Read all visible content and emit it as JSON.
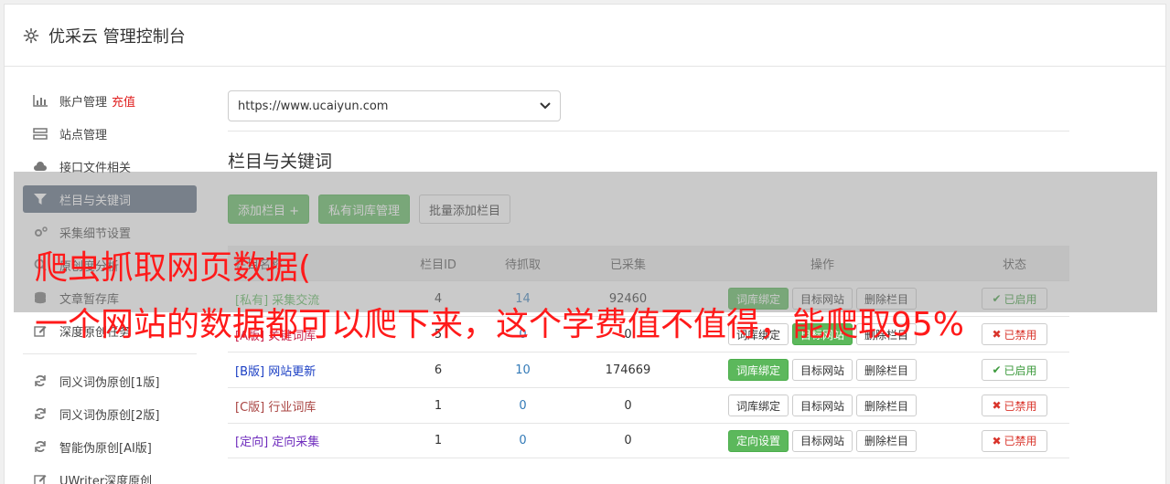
{
  "header": {
    "title": "优采云 管理控制台"
  },
  "sidebar": {
    "items": [
      {
        "label": "账户管理",
        "extra": "充值",
        "icon": "bar-chart-icon"
      },
      {
        "label": "站点管理",
        "icon": "server-icon"
      },
      {
        "label": "接口文件相关",
        "icon": "cloud-upload-icon"
      },
      {
        "label": "栏目与关键词",
        "icon": "filter-icon",
        "active": true
      },
      {
        "label": "采集细节设置",
        "icon": "cogs-icon"
      },
      {
        "label": "原创度分析",
        "icon": "search-icon"
      },
      {
        "label": "文章暂存库",
        "icon": "database-icon"
      },
      {
        "label": "深度原创任务",
        "icon": "edit-icon"
      }
    ],
    "tools": [
      {
        "label": "同义词伪原创[1版]",
        "icon": "refresh-icon"
      },
      {
        "label": "同义词伪原创[2版]",
        "icon": "refresh-icon"
      },
      {
        "label": "智能伪原创[AI版]",
        "icon": "refresh-icon"
      },
      {
        "label": "UWriter深度原创",
        "icon": "edit-icon"
      }
    ]
  },
  "main": {
    "site_select": "https://www.ucaiyun.com",
    "section_title": "栏目与关键词",
    "buttons": {
      "add": "添加栏目 +",
      "private": "私有词库管理",
      "batch": "批量添加栏目"
    },
    "columns": [
      "栏目名称",
      "栏目ID",
      "待抓取",
      "已采集",
      "操作",
      "状态"
    ],
    "rows": [
      {
        "tag": "[私有]",
        "name": "采集交流",
        "id": "4",
        "wait": "14",
        "got": "92460",
        "op1": "词库绑定",
        "op1_green": true,
        "op2": "目标网站",
        "op2_green": false,
        "op3": "删除栏目",
        "status": "已启用",
        "on": true,
        "tag_class": "tag-private"
      },
      {
        "tag": "[A版]",
        "name": "关键词库",
        "id": "5",
        "wait": "0",
        "got": "0",
        "op1": "词库绑定",
        "op1_green": false,
        "op2": "目标网站",
        "op2_green": true,
        "op3": "删除栏目",
        "status": "已禁用",
        "on": false,
        "tag_class": "tag-a"
      },
      {
        "tag": "[B版]",
        "name": "网站更新",
        "id": "6",
        "wait": "10",
        "got": "174669",
        "op1": "词库绑定",
        "op1_green": true,
        "op2": "目标网站",
        "op2_green": false,
        "op3": "删除栏目",
        "status": "已启用",
        "on": true,
        "tag_class": "tag-b"
      },
      {
        "tag": "[C版]",
        "name": "行业词库",
        "id": "1",
        "wait": "0",
        "got": "0",
        "op1": "词库绑定",
        "op1_green": false,
        "op2": "目标网站",
        "op2_green": false,
        "op3": "删除栏目",
        "status": "已禁用",
        "on": false,
        "tag_class": "tag-c"
      },
      {
        "tag": "[定向]",
        "name": "定向采集",
        "id": "1",
        "wait": "0",
        "got": "0",
        "op1": "定向设置",
        "op1_green": true,
        "op2": "目标网站",
        "op2_green": false,
        "op3": "删除栏目",
        "status": "已禁用",
        "on": false,
        "tag_class": "tag-d"
      }
    ]
  },
  "overlay": {
    "line1": "爬虫抓取网页数据(",
    "line2": "一个网站的数据都可以爬下来，这个学费值不值得，能爬取95%"
  }
}
